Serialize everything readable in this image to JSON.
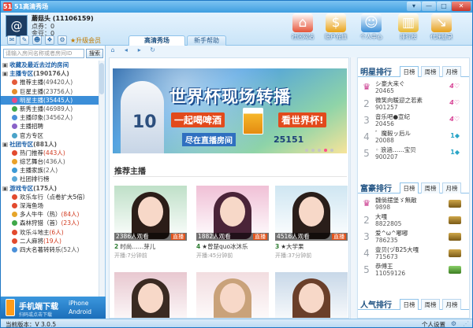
{
  "app": {
    "logo": "51",
    "title": "51高清秀场",
    "controls": [
      "▾",
      "—",
      "□",
      "✕"
    ]
  },
  "user": {
    "name": "蘑菇头 (11106159)",
    "points": "点券：0",
    "gold": "金豆：0",
    "avatar_glyph": "@",
    "promo": "★升级会员"
  },
  "header_nav": [
    {
      "label": "社区网站",
      "icon": "home-icon",
      "glyph": "⌂",
      "color": "#e6553a"
    },
    {
      "label": "账户充值",
      "icon": "coins-icon",
      "glyph": "$",
      "color": "#e9a319"
    },
    {
      "label": "个人中心",
      "icon": "user-icon",
      "glyph": "☺",
      "color": "#3a8fd8"
    },
    {
      "label": "排行榜",
      "icon": "chart-icon",
      "glyph": "▥",
      "color": "#e8b832"
    },
    {
      "label": "代理登录",
      "icon": "arrow-icon",
      "glyph": "↘",
      "color": "#e7a11d"
    }
  ],
  "tabs": [
    {
      "label": "高清秀场",
      "active": true
    },
    {
      "label": "新手帮助",
      "active": false
    }
  ],
  "search": {
    "placeholder": "请输入房间名称或者房间ID",
    "button": "搜索"
  },
  "tree": [
    {
      "type": "cat",
      "mark": "▣",
      "label": "收藏及最近去过的房间",
      "count": ""
    },
    {
      "type": "cat",
      "mark": "▣",
      "label": "主播专区",
      "count": "(190176人)"
    },
    {
      "type": "sub",
      "dot": "#e45b3a",
      "label": "推荐主播",
      "count": "(49420人)"
    },
    {
      "type": "sub",
      "dot": "#e88d2a",
      "label": "巨星主播",
      "count": "(23756人)"
    },
    {
      "type": "sub",
      "dot": "#e84a8a",
      "label": "明星主播",
      "count": "(35445人)",
      "selected": true
    },
    {
      "type": "sub",
      "dot": "#3fa84a",
      "label": "新秀主播",
      "count": "(46989人)"
    },
    {
      "type": "sub",
      "dot": "#4a90d9",
      "label": "主播印象",
      "count": "(34562人)"
    },
    {
      "type": "sub",
      "dot": "#8a62c8",
      "label": "主播招聘",
      "count": ""
    },
    {
      "type": "sub",
      "dot": "#4aa3c9",
      "label": "官方专区",
      "count": ""
    },
    {
      "type": "cat",
      "mark": "▣",
      "label": "社团专区",
      "count": "(881人)"
    },
    {
      "type": "sub",
      "dot": "#e24a2e",
      "label": "热门推荐",
      "count": "(443人)",
      "hot": true
    },
    {
      "type": "sub",
      "dot": "#e9a12a",
      "label": "综艺舞台",
      "count": "(436人)"
    },
    {
      "type": "sub",
      "dot": "#3d9ad6",
      "label": "主播家族",
      "count": "(2人)"
    },
    {
      "type": "sub",
      "dot": "#5aa9d8",
      "label": "社团排行榜",
      "count": ""
    },
    {
      "type": "cat",
      "mark": "▣",
      "label": "游戏专区",
      "count": "(175人)"
    },
    {
      "type": "sub",
      "dot": "#e24a2e",
      "label": "欢乐车行（点卷扩大5倍）",
      "count": "",
      "hot": true
    },
    {
      "type": "sub",
      "dot": "#e24a2e",
      "label": "深海鱼场",
      "count": "",
      "hot": true
    },
    {
      "type": "sub",
      "dot": "#e6a52a",
      "label": "多人牛牛（热）",
      "count": "(84人)",
      "hot": true
    },
    {
      "type": "sub",
      "dot": "#3fa84a",
      "label": "森林狩猎（首）",
      "count": "(23人)",
      "hot": true
    },
    {
      "type": "sub",
      "dot": "#e24a2e",
      "label": "欢乐斗地主",
      "count": "(6人)",
      "hot": true
    },
    {
      "type": "sub",
      "dot": "#e24a2e",
      "label": "二人麻将",
      "count": "(19人)",
      "hot": true
    },
    {
      "type": "sub",
      "dot": "#4a90d9",
      "label": "四大名著转转乐",
      "count": "(52人)"
    }
  ],
  "download": {
    "title": "手机端下载",
    "caption": "扫码或点击下载",
    "platform1": "iPhone",
    "platform2": "Android"
  },
  "toolbar_icons": [
    "⌂",
    "◂",
    "▸",
    "↻"
  ],
  "banner": {
    "title": "世界杯现场转播",
    "sub1": "一起喝啤酒",
    "sub2": "看世界杯!",
    "line": "尽在直播房间",
    "room": "25151",
    "shirt_number": "10",
    "slides": 5,
    "active_slide": 4
  },
  "section_title": "推荐主播",
  "cards": [
    {
      "viewers": "2386人观看",
      "live": "直播",
      "level": "2",
      "name": "时尚……芽儿",
      "time": "开播:7分钟前",
      "bg": "#bfe0c8",
      "hair": "#2b1d18"
    },
    {
      "viewers": "1882人观看",
      "live": "直播",
      "level": "4",
      "name": "★曾楚quo冰沐乐",
      "time": "开播:45分钟前",
      "bg": "#f0c0d6",
      "hair": "#4a2438"
    },
    {
      "viewers": "4516人观看",
      "live": "直播",
      "level": "3",
      "name": "★大学果",
      "time": "开播:37分钟前",
      "bg": "#cfe6f2",
      "hair": "#2a1e1a"
    },
    {
      "viewers": "",
      "live": "",
      "level": "",
      "name": "",
      "time": "",
      "bg": "#e8c8d0",
      "hair": "#3a2a22"
    },
    {
      "viewers": "",
      "live": "",
      "level": "",
      "name": "",
      "time": "",
      "bg": "#f2dde0",
      "hair": "#c9a27a"
    },
    {
      "viewers": "",
      "live": "",
      "level": "",
      "name": "",
      "time": "",
      "bg": "#c8d8e8",
      "hair": "#6a3f2a"
    }
  ],
  "rank_tabs": [
    "日榜",
    "周榜",
    "月榜"
  ],
  "star_rank": {
    "title": "明星排行",
    "rows": [
      {
        "rank": "♛",
        "crown": true,
        "name": "シ豪大来ぐ",
        "value": "20465",
        "badge": "4♡"
      },
      {
        "rank": "2",
        "name": "微笑向暖迎之若素",
        "value": "901257",
        "badge": "4♡"
      },
      {
        "rank": "3",
        "name": "音乐吧●宣纪",
        "value": "20456",
        "badge": "4♡"
      },
      {
        "rank": "4",
        "name": "゛魔毅ッ后ル",
        "value": "20088",
        "badge": "1◆",
        "diamond": true
      },
      {
        "rank": "5",
        "name": "◦ 浪涵……宝贝",
        "value": "900207",
        "badge": "1◆",
        "diamond": true
      }
    ]
  },
  "rich_rank": {
    "title": "富豪排行",
    "rows": [
      {
        "rank": "♛",
        "crown": true,
        "name": "魏倘摆堡ゞ無敵",
        "value": "9898",
        "rb": "a"
      },
      {
        "rank": "2",
        "name": "大嘎",
        "value": "8822805",
        "rb": "a"
      },
      {
        "rank": "3",
        "name": "爱^ω^嘟嘟",
        "value": "786235",
        "rb": "a"
      },
      {
        "rank": "4",
        "name": "壹贝(ヅB25大嘎",
        "value": "715673",
        "rb": "a"
      },
      {
        "rank": "5",
        "name": "恭傅王",
        "value": "11059126",
        "rb": "b"
      }
    ]
  },
  "pop_rank": {
    "title": "人气排行"
  },
  "status": {
    "version": "当前版本：V 3.0.5",
    "settings": "个人设置",
    "gear": "⚙",
    "grip": "⋰"
  }
}
